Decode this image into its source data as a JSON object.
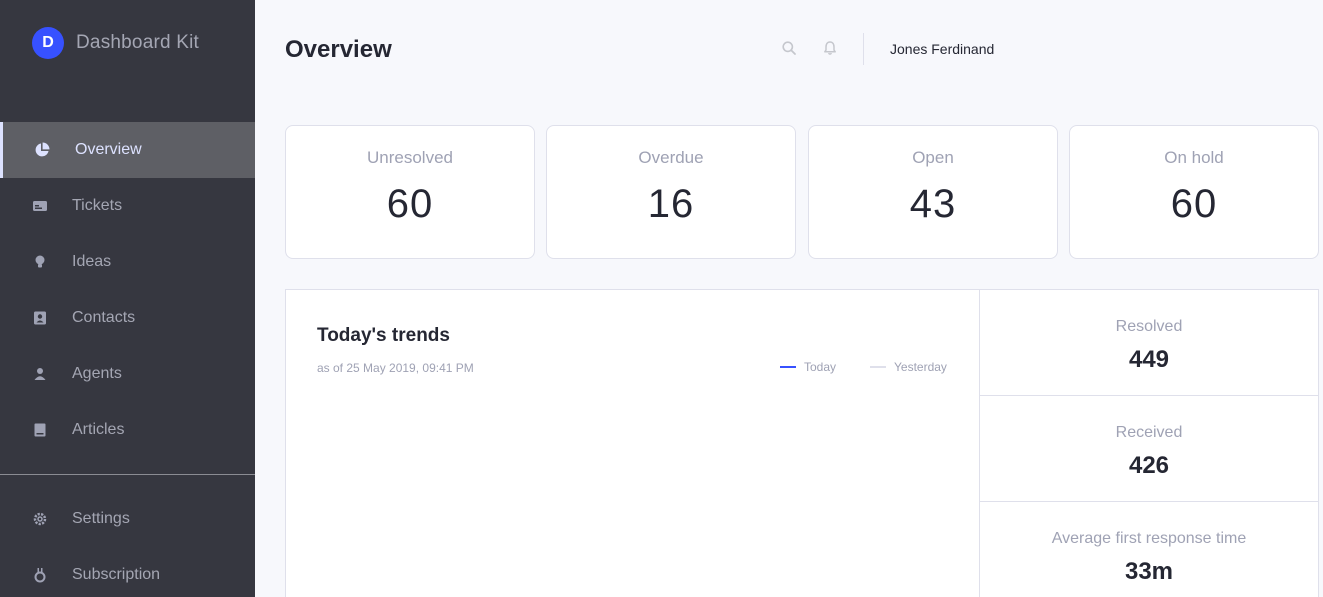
{
  "brand": {
    "logo_letter": "D",
    "name": "Dashboard Kit"
  },
  "sidebar": {
    "items": [
      {
        "label": "Overview",
        "icon": "pie-chart-icon",
        "active": true
      },
      {
        "label": "Tickets",
        "icon": "ticket-icon"
      },
      {
        "label": "Ideas",
        "icon": "lightbulb-icon"
      },
      {
        "label": "Contacts",
        "icon": "contacts-icon"
      },
      {
        "label": "Agents",
        "icon": "user-icon"
      },
      {
        "label": "Articles",
        "icon": "book-icon"
      }
    ],
    "footer_items": [
      {
        "label": "Settings",
        "icon": "gear-icon"
      },
      {
        "label": "Subscription",
        "icon": "medal-icon"
      }
    ]
  },
  "header": {
    "title": "Overview",
    "user_name": "Jones Ferdinand",
    "icons": [
      "search-icon",
      "bell-icon"
    ]
  },
  "stats": [
    {
      "label": "Unresolved",
      "value": "60"
    },
    {
      "label": "Overdue",
      "value": "16"
    },
    {
      "label": "Open",
      "value": "43"
    },
    {
      "label": "On hold",
      "value": "60"
    }
  ],
  "trends": {
    "title": "Today's trends",
    "subtitle": "as of 25 May 2019, 09:41 PM",
    "legend": [
      {
        "label": "Today",
        "color": "#3751ff"
      },
      {
        "label": "Yesterday",
        "color": "#dfe0eb"
      }
    ]
  },
  "side_stats": [
    {
      "label": "Resolved",
      "value": "449"
    },
    {
      "label": "Received",
      "value": "426"
    },
    {
      "label": "Average first response time",
      "value": "33m"
    }
  ],
  "colors": {
    "sidebar_bg": "#363740",
    "accent": "#3751ff",
    "page_bg": "#f7f8fc"
  }
}
